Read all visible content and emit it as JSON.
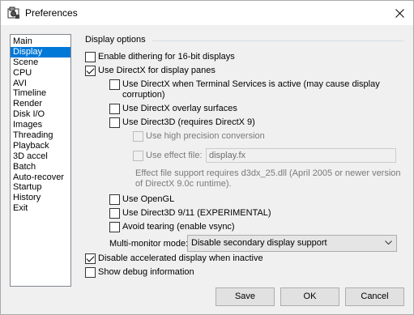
{
  "window": {
    "title": "Preferences",
    "close_glyph": "✕"
  },
  "categories": [
    {
      "label": "Main"
    },
    {
      "label": "Display"
    },
    {
      "label": "Scene"
    },
    {
      "label": "CPU"
    },
    {
      "label": "AVI"
    },
    {
      "label": "Timeline"
    },
    {
      "label": "Render"
    },
    {
      "label": "Disk I/O"
    },
    {
      "label": "Images"
    },
    {
      "label": "Threading"
    },
    {
      "label": "Playback"
    },
    {
      "label": "3D accel"
    },
    {
      "label": "Batch"
    },
    {
      "label": "Auto-recover"
    },
    {
      "label": "Startup"
    },
    {
      "label": "History"
    },
    {
      "label": "Exit"
    }
  ],
  "selected_category": "Display",
  "display_options": {
    "group_label": "Display options",
    "dithering": {
      "label": "Enable dithering for 16-bit displays",
      "checked": false
    },
    "directx": {
      "label": "Use DirectX for display panes",
      "checked": true
    },
    "directx_ts": {
      "label": "Use DirectX when Terminal Services is active (may cause display",
      "label2": "corruption)",
      "checked": false
    },
    "directx_overlay": {
      "label": "Use DirectX overlay surfaces",
      "checked": false
    },
    "direct3d": {
      "label": "Use Direct3D (requires DirectX 9)",
      "checked": false
    },
    "high_precision": {
      "label": "Use high precision conversion",
      "checked": false,
      "disabled": true
    },
    "effect_file": {
      "label": "Use effect file:",
      "checked": false,
      "disabled": true,
      "value": "display.fx"
    },
    "effect_note": {
      "line1": "Effect file support requires d3dx_25.dll (April 2005 or newer version",
      "line2": "of DirectX 9.0c runtime)."
    },
    "opengl": {
      "label": "Use OpenGL",
      "checked": false
    },
    "direct3d_911": {
      "label": "Use Direct3D 9/11 (EXPERIMENTAL)",
      "checked": false
    },
    "avoid_tearing": {
      "label": "Avoid tearing (enable vsync)",
      "checked": false
    },
    "multimonitor": {
      "label": "Multi-monitor mode:",
      "value": "Disable secondary display support"
    },
    "disable_accel": {
      "label": "Disable accelerated display when inactive",
      "checked": true
    },
    "debug_info": {
      "label": "Show debug information",
      "checked": false
    }
  },
  "buttons": {
    "save": "Save",
    "ok": "OK",
    "cancel": "Cancel"
  },
  "colors": {
    "selection": "#0078d7",
    "window_bg": "#f0f0f0"
  }
}
